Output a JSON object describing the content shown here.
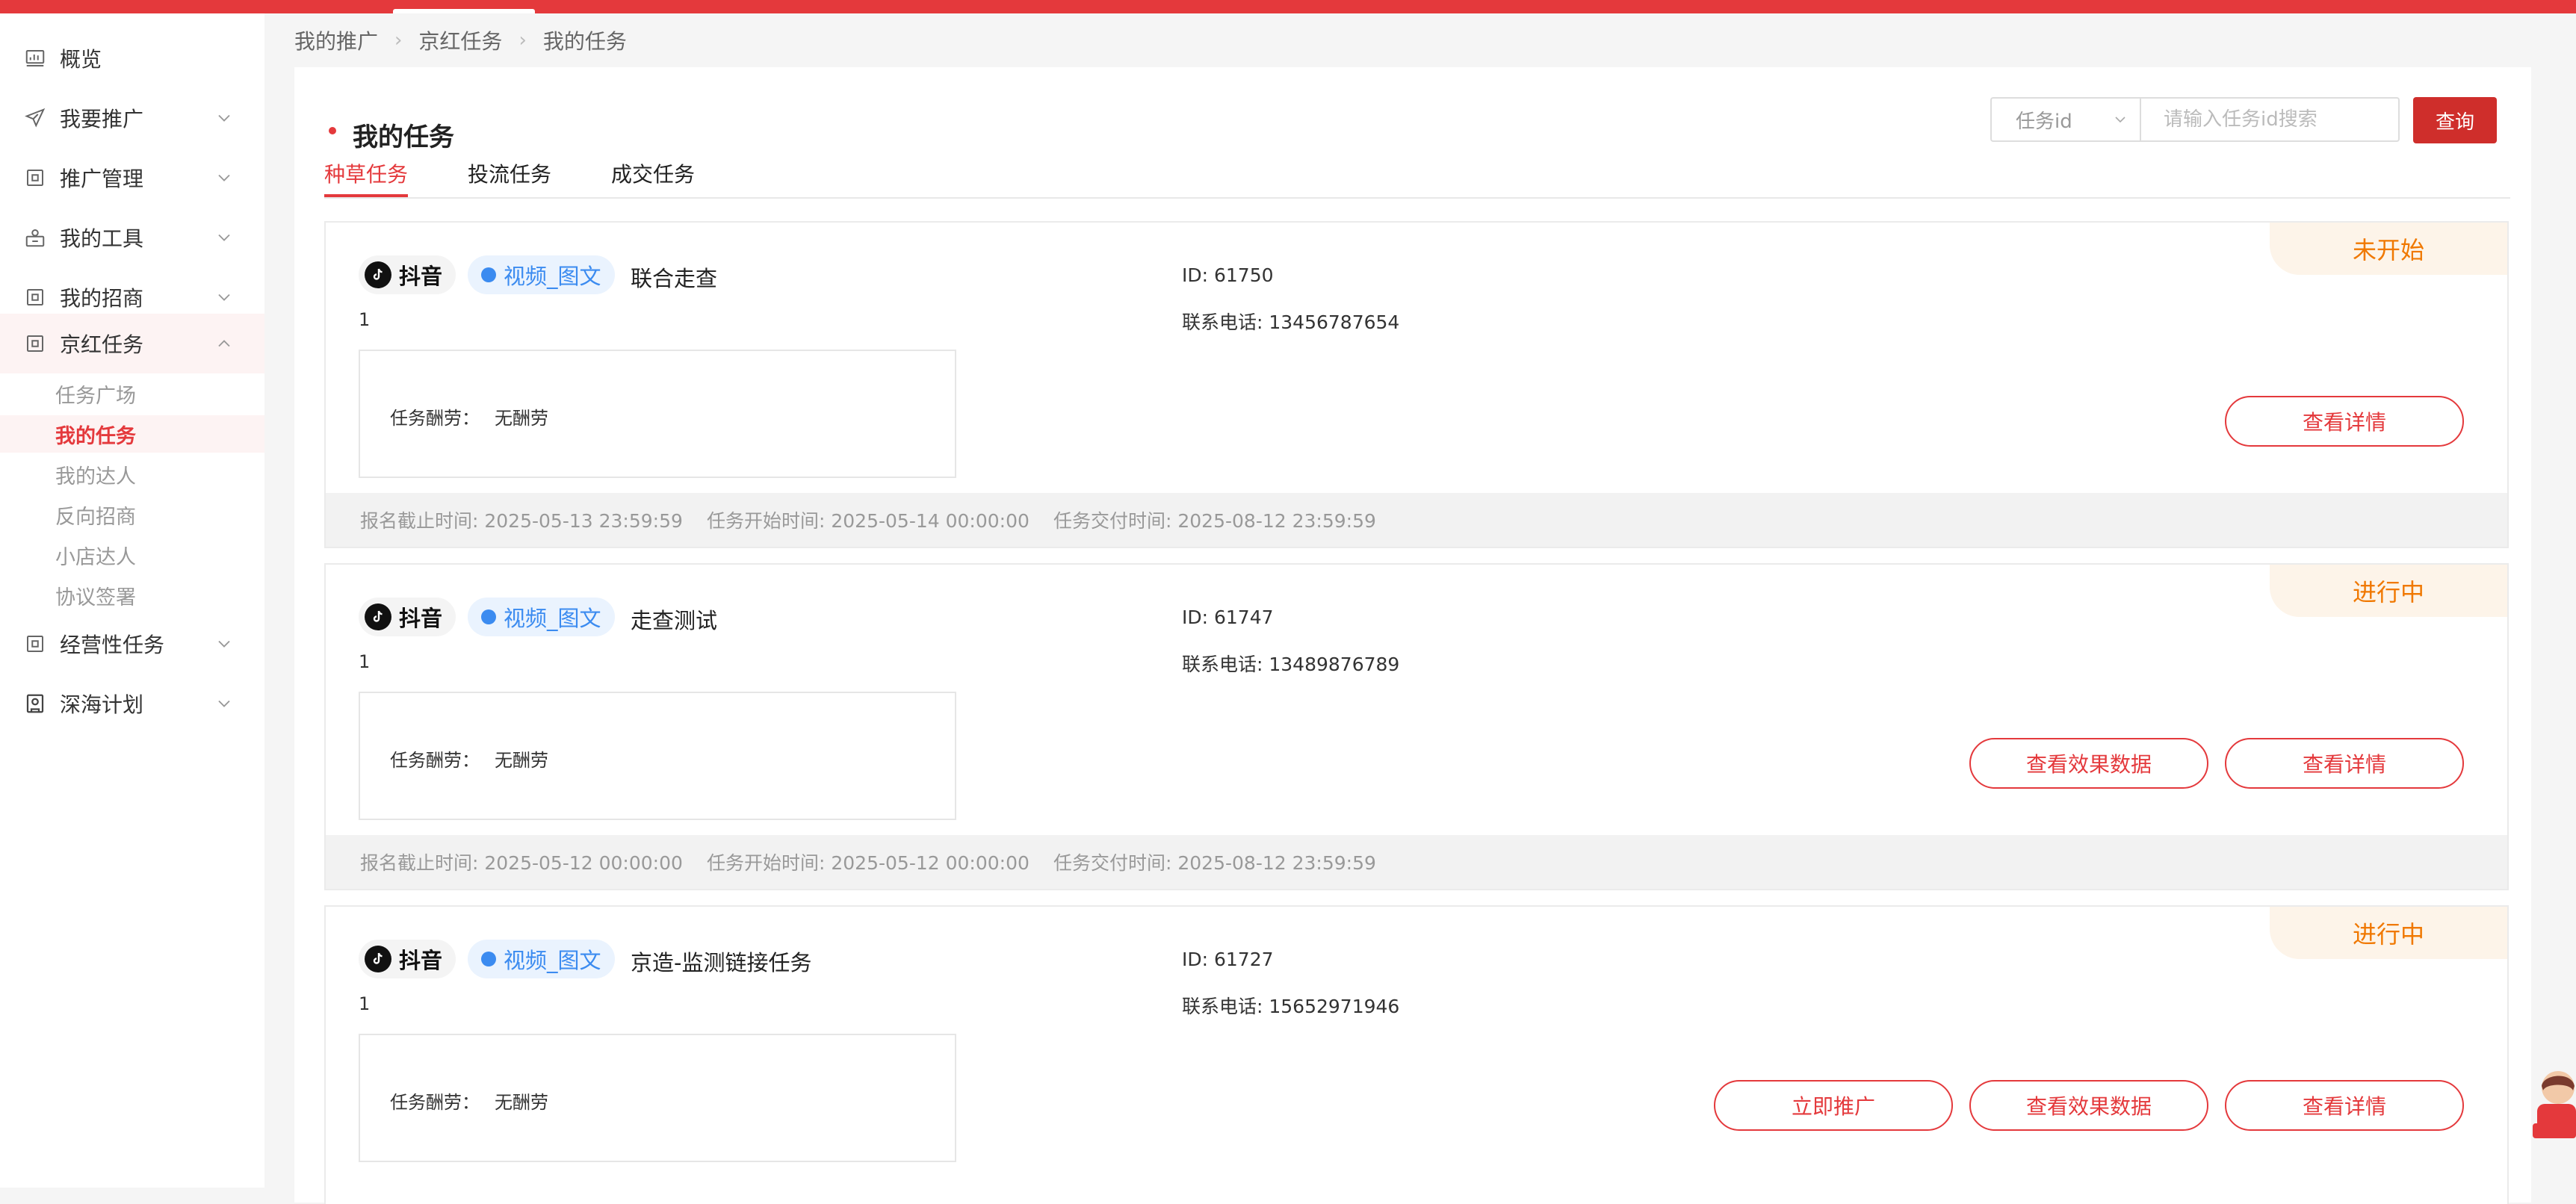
{
  "sidebar": {
    "items": [
      {
        "label": "概览",
        "icon": "dashboard-icon",
        "chevron": ""
      },
      {
        "label": "我要推广",
        "icon": "send-icon",
        "chevron": "down"
      },
      {
        "label": "推广管理",
        "icon": "grid-icon",
        "chevron": "down"
      },
      {
        "label": "我的工具",
        "icon": "tools-icon",
        "chevron": "down"
      },
      {
        "label": "我的招商",
        "icon": "grid-icon",
        "chevron": "down"
      },
      {
        "label": "京红任务",
        "icon": "grid-icon",
        "chevron": "up"
      },
      {
        "label": "经营性任务",
        "icon": "grid-icon",
        "chevron": "down"
      },
      {
        "label": "深海计划",
        "icon": "building-icon",
        "chevron": "down"
      }
    ],
    "sub_items": [
      {
        "label": "任务广场"
      },
      {
        "label": "我的任务"
      },
      {
        "label": "我的达人"
      },
      {
        "label": "反向招商"
      },
      {
        "label": "小店达人"
      },
      {
        "label": "协议签署"
      }
    ],
    "active_sub": "我的任务"
  },
  "breadcrumb": [
    "我的推广",
    "京红任务",
    "我的任务"
  ],
  "page": {
    "title": "我的任务",
    "tabs": [
      "种草任务",
      "投流任务",
      "成交任务"
    ],
    "active_tab": "种草任务"
  },
  "search": {
    "select_value": "任务id",
    "placeholder": "请输入任务id搜索",
    "value": "",
    "button_label": "查询"
  },
  "tasks": [
    {
      "platform": "抖音",
      "type": "视频_图文",
      "name": "联合走查",
      "sub": "1",
      "id_label": "ID: 61750",
      "phone_label": "联系电话: 13456787654",
      "reward_label": "任务酬劳：",
      "reward_value": "无酬劳",
      "status": "未开始",
      "buttons": [
        "查看详情"
      ],
      "deadline": "报名截止时间: 2025-05-13 23:59:59",
      "start": "任务开始时间: 2025-05-14 00:00:00",
      "delivery": "任务交付时间: 2025-08-12 23:59:59"
    },
    {
      "platform": "抖音",
      "type": "视频_图文",
      "name": "走查测试",
      "sub": "1",
      "id_label": "ID: 61747",
      "phone_label": "联系电话: 13489876789",
      "reward_label": "任务酬劳：",
      "reward_value": "无酬劳",
      "status": "进行中",
      "buttons": [
        "查看效果数据",
        "查看详情"
      ],
      "deadline": "报名截止时间: 2025-05-12 00:00:00",
      "start": "任务开始时间: 2025-05-12 00:00:00",
      "delivery": "任务交付时间: 2025-08-12 23:59:59"
    },
    {
      "platform": "抖音",
      "type": "视频_图文",
      "name": "京造-监测链接任务",
      "sub": "1",
      "id_label": "ID: 61727",
      "phone_label": "联系电话: 15652971946",
      "reward_label": "任务酬劳：",
      "reward_value": "无酬劳",
      "status": "进行中",
      "buttons": [
        "立即推广",
        "查看效果数据",
        "查看详情"
      ],
      "deadline": "",
      "start": "",
      "delivery": ""
    }
  ],
  "colors": {
    "accent": "#e4393c",
    "status": "#f07800",
    "tag": "#3b8bf0"
  }
}
